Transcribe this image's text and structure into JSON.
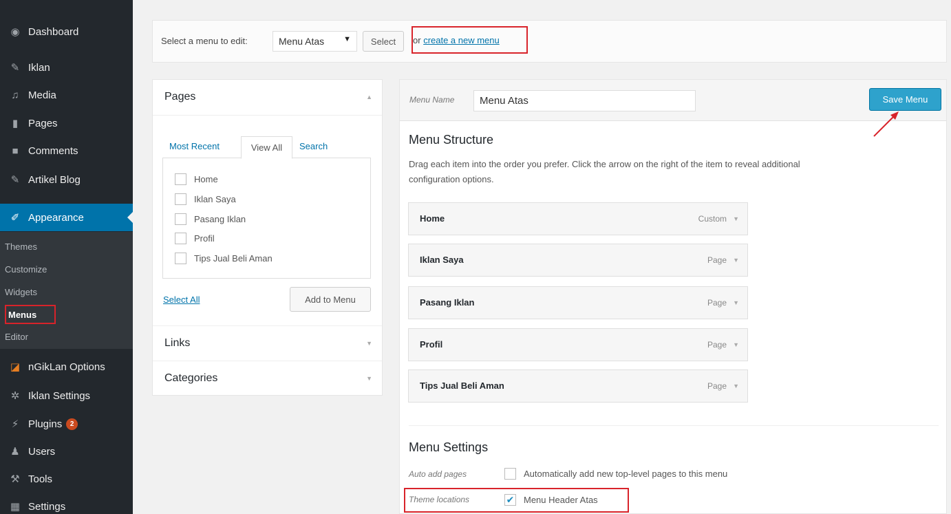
{
  "sidebar": {
    "items": [
      {
        "label": "Dashboard",
        "icon": "dashboard-icon"
      },
      {
        "label": "Iklan",
        "icon": "pin-icon"
      },
      {
        "label": "Media",
        "icon": "media-icon"
      },
      {
        "label": "Pages",
        "icon": "pages-icon"
      },
      {
        "label": "Comments",
        "icon": "comments-icon"
      },
      {
        "label": "Artikel Blog",
        "icon": "pin-icon"
      },
      {
        "label": "Appearance",
        "icon": "paintbrush-icon"
      },
      {
        "label": "nGikLan Options",
        "icon": "options-icon"
      },
      {
        "label": "Iklan Settings",
        "icon": "gear-icon"
      },
      {
        "label": "Plugins",
        "icon": "plugin-icon",
        "badge": "2"
      },
      {
        "label": "Users",
        "icon": "users-icon"
      },
      {
        "label": "Tools",
        "icon": "wrench-icon"
      },
      {
        "label": "Settings",
        "icon": "settings-icon"
      }
    ],
    "submenu": [
      "Themes",
      "Customize",
      "Widgets",
      "Menus",
      "Editor"
    ]
  },
  "topbar": {
    "label": "Select a menu to edit:",
    "selected_menu": "Menu Atas",
    "select_button": "Select",
    "or_text": "or",
    "create_link": "create a new menu"
  },
  "left_panel": {
    "pages_title": "Pages",
    "tabs": [
      "Most Recent",
      "View All",
      "Search"
    ],
    "pages": [
      "Home",
      "Iklan Saya",
      "Pasang Iklan",
      "Profil",
      "Tips Jual Beli Aman"
    ],
    "select_all": "Select All",
    "add_button": "Add to Menu",
    "links_title": "Links",
    "categories_title": "Categories"
  },
  "right_panel": {
    "menu_name_label": "Menu Name",
    "menu_name_value": "Menu Atas",
    "save_button": "Save Menu",
    "structure_title": "Menu Structure",
    "structure_desc_line1": "Drag each item into the order you prefer. Click the arrow on the right of the item to reveal additional",
    "structure_desc_line2": "configuration options.",
    "menu_items": [
      {
        "title": "Home",
        "type": "Custom"
      },
      {
        "title": "Iklan Saya",
        "type": "Page"
      },
      {
        "title": "Pasang Iklan",
        "type": "Page"
      },
      {
        "title": "Profil",
        "type": "Page"
      },
      {
        "title": "Tips Jual Beli Aman",
        "type": "Page"
      }
    ],
    "settings_title": "Menu Settings",
    "auto_add_label": "Auto add pages",
    "auto_add_text": "Automatically add new top-level pages to this menu",
    "theme_locations_label": "Theme locations",
    "theme_location_text": "Menu Header Atas"
  },
  "colors": {
    "sidebar_bg": "#23282d",
    "active_bg": "#0073aa",
    "save_button": "#2ea2cc",
    "highlight_red": "#d8232a"
  }
}
